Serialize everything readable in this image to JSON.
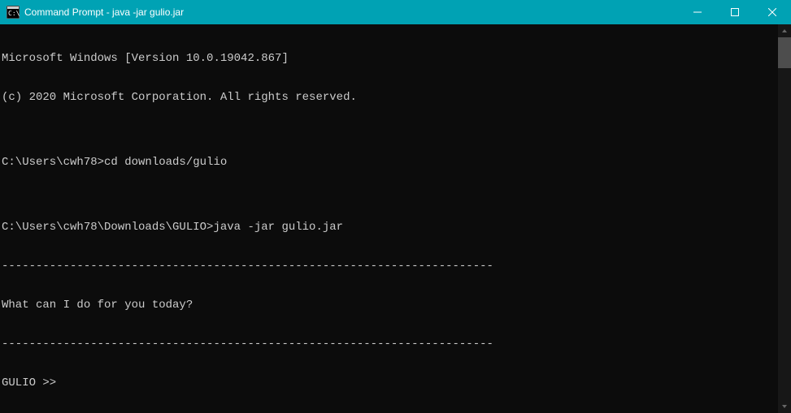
{
  "titlebar": {
    "title": "Command Prompt - java  -jar gulio.jar"
  },
  "terminal": {
    "lines": [
      "Microsoft Windows [Version 10.0.19042.867]",
      "(c) 2020 Microsoft Corporation. All rights reserved.",
      "",
      "C:\\Users\\cwh78>cd downloads/gulio",
      "",
      "C:\\Users\\cwh78\\Downloads\\GULIO>java -jar gulio.jar",
      "------------------------------------------------------------------------",
      "What can I do for you today?",
      "------------------------------------------------------------------------",
      "GULIO >>"
    ]
  }
}
